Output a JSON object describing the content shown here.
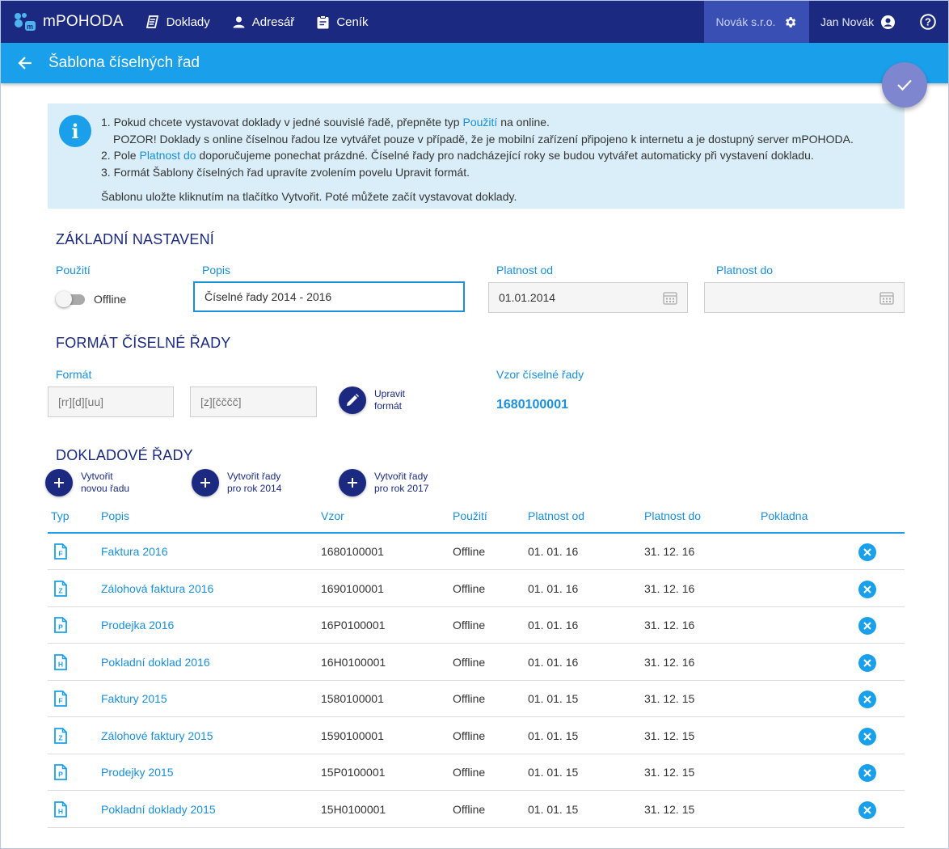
{
  "app": {
    "brand": "mPOHODA",
    "nav": [
      {
        "label": "Doklady",
        "icon": "documents-icon"
      },
      {
        "label": "Adresář",
        "icon": "person-icon"
      },
      {
        "label": "Ceník",
        "icon": "clipboard-icon"
      }
    ],
    "company": "Novák s.r.o.",
    "user": "Jan Novák"
  },
  "header": {
    "title": "Šablona číselných řad"
  },
  "info": {
    "line1_pre": "1. Pokud chcete vystavovat doklady v jedné souvislé řadě, přepněte typ ",
    "line1_link": "Použití",
    "line1_post": " na online.",
    "line2": "POZOR! Doklady s online číselnou řadou lze vytvářet pouze v případě, že je mobilní zařízení připojeno k internetu a je dostupný server mPOHODA.",
    "line3_pre": "2. Pole ",
    "line3_link": "Platnost do",
    "line3_post": " doporučujeme ponechat prázdné. Číselné řady pro nadcházející roky se budou vytvářet automaticky při vystavení dokladu.",
    "line4": "3. Formát Šablony číselných řad upravíte zvolením povelu Upravit formát.",
    "line5": "Šablonu uložte kliknutím na tlačítko Vytvořit. Poté můžete začít vystavovat doklady."
  },
  "basic": {
    "title": "ZÁKLADNÍ NASTAVENÍ",
    "usage_label": "Použití",
    "usage_value": "Offline",
    "desc_label": "Popis",
    "desc_value": "Číselné řady 2014 - 2016",
    "valid_from_label": "Platnost od",
    "valid_from_value": "01.01.2014",
    "valid_to_label": "Platnost do",
    "valid_to_value": ""
  },
  "format": {
    "title": "FORMÁT ČÍSELNÉ ŘADY",
    "format_label": "Formát",
    "format1": "[rr][d][uu]",
    "format2": "[z][čččč]",
    "edit_line1": "Upravit",
    "edit_line2": "formát",
    "pattern_label": "Vzor číselné řady",
    "pattern_value": "1680100001"
  },
  "series": {
    "title": "DOKLADOVÉ ŘADY",
    "actions": [
      {
        "line1": "Vytvořit",
        "line2": "novou řadu"
      },
      {
        "line1": "Vytvořit řady",
        "line2": "pro rok 2014"
      },
      {
        "line1": "Vytvořit řady",
        "line2": "pro rok 2017"
      }
    ],
    "columns": [
      "Typ",
      "Popis",
      "Vzor",
      "Použití",
      "Platnost od",
      "Platnost do",
      "Pokladna"
    ],
    "rows": [
      {
        "type": "F",
        "desc": "Faktura 2016",
        "pattern": "1680100001",
        "usage": "Offline",
        "from": "01. 01. 16",
        "to": "31. 12. 16"
      },
      {
        "type": "Z",
        "desc": "Zálohová faktura 2016",
        "pattern": "1690100001",
        "usage": "Offline",
        "from": "01. 01. 16",
        "to": "31. 12. 16"
      },
      {
        "type": "P",
        "desc": "Prodejka 2016",
        "pattern": "16P0100001",
        "usage": "Offline",
        "from": "01. 01. 16",
        "to": "31. 12. 16"
      },
      {
        "type": "H",
        "desc": "Pokladní doklad 2016",
        "pattern": "16H0100001",
        "usage": "Offline",
        "from": "01. 01. 16",
        "to": "31. 12. 16"
      },
      {
        "type": "F",
        "desc": "Faktury 2015",
        "pattern": "1580100001",
        "usage": "Offline",
        "from": "01. 01. 15",
        "to": "31. 12. 15"
      },
      {
        "type": "Z",
        "desc": "Zálohové faktury 2015",
        "pattern": "1590100001",
        "usage": "Offline",
        "from": "01. 01. 15",
        "to": "31. 12. 15"
      },
      {
        "type": "P",
        "desc": "Prodejky 2015",
        "pattern": "15P0100001",
        "usage": "Offline",
        "from": "01. 01. 15",
        "to": "31. 12. 15"
      },
      {
        "type": "H",
        "desc": "Pokladní doklady 2015",
        "pattern": "15H0100001",
        "usage": "Offline",
        "from": "01. 01. 15",
        "to": "31. 12. 15"
      }
    ]
  },
  "colors": {
    "navbar": "#1b2a80",
    "accent": "#1aa0ea",
    "fab": "#7e86cf"
  }
}
